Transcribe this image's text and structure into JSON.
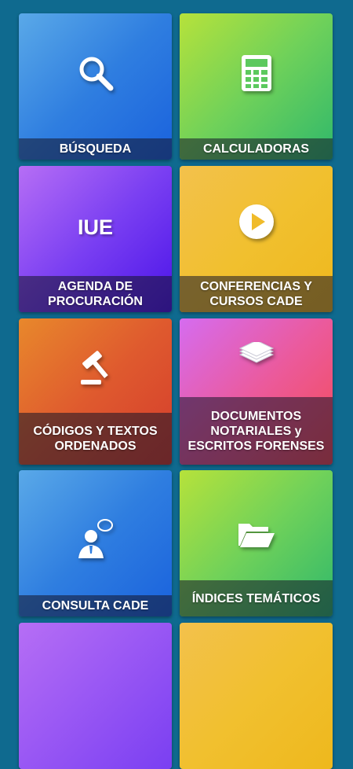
{
  "tiles": [
    {
      "label": "BÚSQUEDA",
      "icon": "search-icon"
    },
    {
      "label": "CALCULADORAS",
      "icon": "calculator-icon"
    },
    {
      "label": "AGENDA DE PROCURACIÓN",
      "icon_text": "IUE"
    },
    {
      "label": "CONFERENCIAS Y CURSOS CADE",
      "icon": "play-icon"
    },
    {
      "label": "CÓDIGOS Y TEXTOS ORDENADOS",
      "icon": "gavel-icon"
    },
    {
      "label": "DOCUMENTOS NOTARIALES y ESCRITOS FORENSES",
      "icon": "documents-stack-icon"
    },
    {
      "label": "CONSULTA CADE",
      "icon": "consultant-icon"
    },
    {
      "label": "ÍNDICES TEMÁTICOS",
      "icon": "open-folder-icon"
    }
  ],
  "colors": {
    "background": "#0f6a8f",
    "blue": "#2f7ee0",
    "green": "#6fd15a",
    "purple": "#7a3ff2",
    "yellow": "#f1c02f",
    "orange": "#df5a2e",
    "magenta": "#eb5a9c"
  }
}
